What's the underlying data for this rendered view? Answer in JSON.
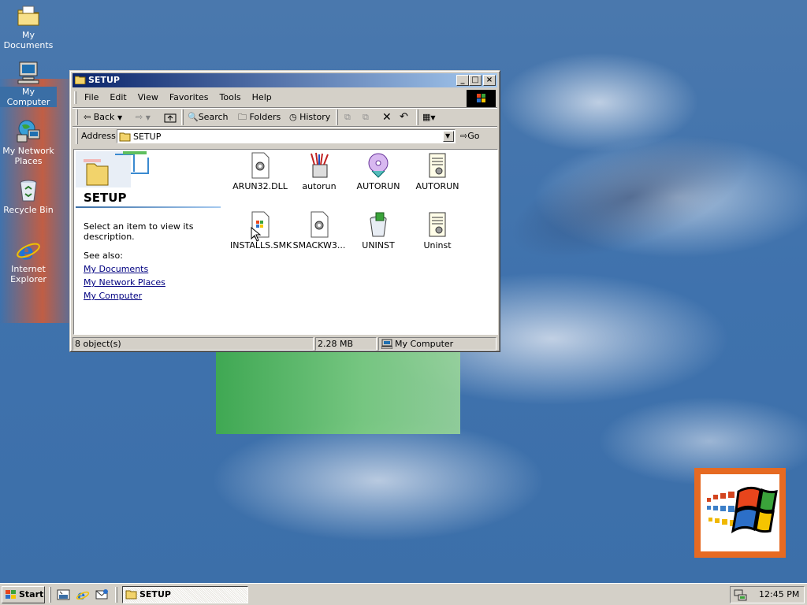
{
  "desktop": {
    "icons": [
      {
        "label": "My Documents",
        "icon": "my-documents-folder-icon"
      },
      {
        "label": "My Computer",
        "icon": "my-computer-icon"
      },
      {
        "label": "My Network Places",
        "icon": "network-places-icon"
      },
      {
        "label": "Recycle Bin",
        "icon": "recycle-bin-icon"
      },
      {
        "label": "Internet Explorer",
        "icon": "internet-explorer-icon"
      }
    ]
  },
  "window": {
    "title": "SETUP",
    "menu": [
      "File",
      "Edit",
      "View",
      "Favorites",
      "Tools",
      "Help"
    ],
    "toolbar": {
      "back": "Back",
      "search": "Search",
      "folders": "Folders",
      "history": "History"
    },
    "address": {
      "label": "Address",
      "value": "SETUP",
      "go": "Go"
    },
    "left_pane": {
      "title": "SETUP",
      "description": "Select an item to view its description.",
      "see_also": "See also:",
      "links": [
        "My Documents",
        "My Network Places",
        "My Computer"
      ]
    },
    "files": [
      {
        "name": "ARUN32.DLL",
        "icon": "dll-gear-file-icon"
      },
      {
        "name": "autorun",
        "icon": "autorun-paint-icon"
      },
      {
        "name": "AUTORUN",
        "icon": "autorun-cd-icon"
      },
      {
        "name": "AUTORUN",
        "icon": "autorun-inf-notepad-icon"
      },
      {
        "name": "INSTALLS.SMK",
        "icon": "smk-media-file-icon"
      },
      {
        "name": "SMACKW3...",
        "icon": "dll-gear-file-icon"
      },
      {
        "name": "UNINST",
        "icon": "uninstall-recycle-icon"
      },
      {
        "name": "Uninst",
        "icon": "uninst-notepad-icon"
      }
    ],
    "status": {
      "objects": "8 object(s)",
      "size": "2.28 MB",
      "zone": "My Computer"
    }
  },
  "taskbar": {
    "start": "Start",
    "task": "SETUP",
    "clock": "12:45 PM"
  },
  "colors": {
    "title_active_start": "#0a246a",
    "title_active_end": "#a6caf0",
    "face": "#d4d0c8",
    "desktop": "#3a6ea5",
    "link": "#000080"
  }
}
